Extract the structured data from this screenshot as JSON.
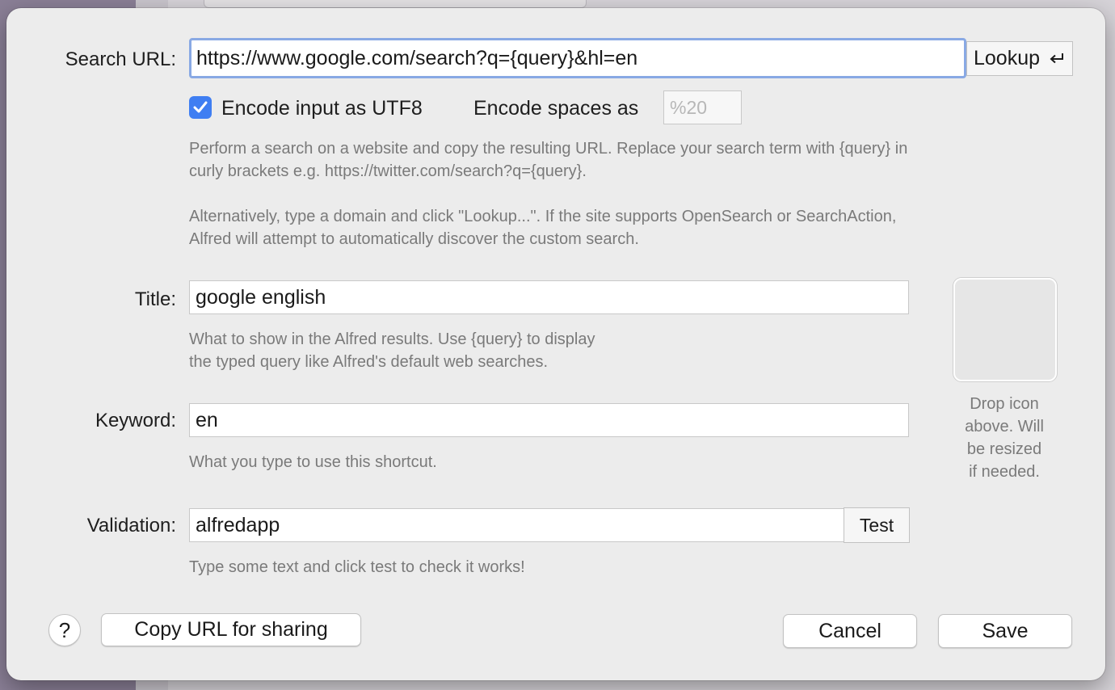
{
  "dialog": {
    "search_url": {
      "label": "Search URL:",
      "value": "https://www.google.com/search?q={query}&hl=en",
      "lookup_button": "Lookup",
      "lookup_icon": "return-key-icon"
    },
    "encode_utf8": {
      "label": "Encode input as UTF8",
      "checked": true
    },
    "encode_spaces": {
      "label": "Encode spaces as",
      "placeholder": "%20"
    },
    "description": {
      "line1": "Perform a search on a website and copy the resulting URL. Replace your search term with {query} in",
      "line2": "curly brackets e.g. https://twitter.com/search?q={query}.",
      "line3": "Alternatively, type a domain and click \"Lookup...\". If the site supports OpenSearch or SearchAction,",
      "line4": "Alfred will attempt to automatically discover the custom search."
    },
    "title": {
      "label": "Title:",
      "value": "google english",
      "help_line1": "What to show in the Alfred results. Use {query} to display",
      "help_line2": "the typed query like Alfred's default web searches."
    },
    "keyword": {
      "label": "Keyword:",
      "value": "en",
      "help": "What you type to use this shortcut."
    },
    "validation": {
      "label": "Validation:",
      "value": "alfredapp",
      "test_button": "Test",
      "help": "Type some text and click test to check it works!"
    },
    "icon_well": {
      "help_line1": "Drop icon",
      "help_line2": "above. Will",
      "help_line3": "be resized",
      "help_line4": "if needed."
    },
    "footer": {
      "help_button": "?",
      "copy_url_button": "Copy URL for sharing",
      "cancel_button": "Cancel",
      "save_button": "Save"
    }
  },
  "colors": {
    "sheet_bg": "#ececec",
    "accent_blue": "#3f7ef2",
    "focus_ring": "#89a9e4",
    "help_text": "#7a7a7a"
  }
}
